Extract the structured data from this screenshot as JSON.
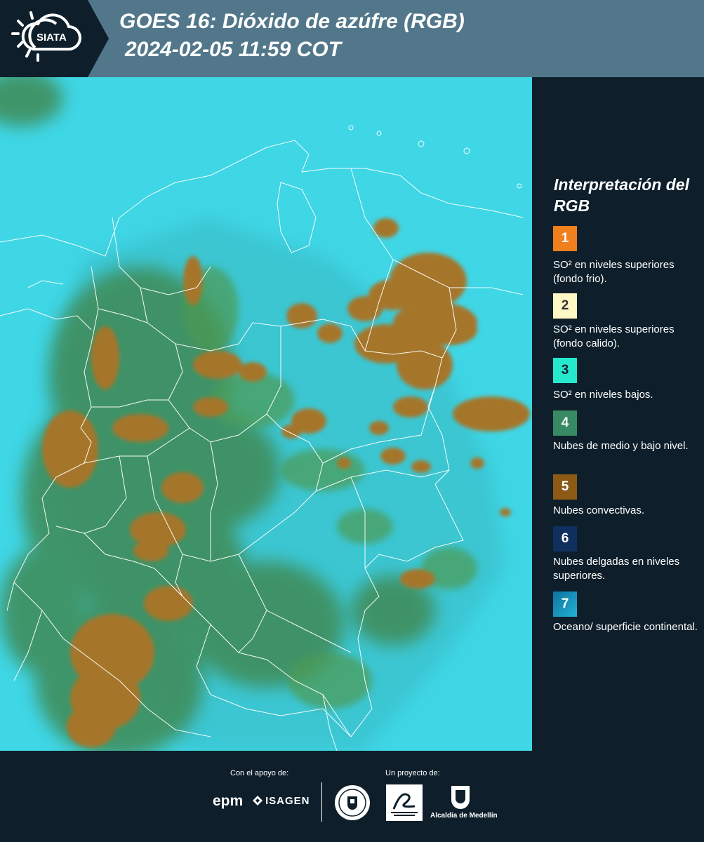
{
  "header": {
    "logo_text": "SIATA",
    "title_line1": "GOES 16: Dióxido de azúfre (RGB)",
    "title_line2": "2024-02-05 11:59 COT"
  },
  "legend": {
    "title": "Interpretación del RGB",
    "items": [
      {
        "number": "1",
        "label": "SO² en niveles superiores (fondo frio).",
        "color": "#f07f1d"
      },
      {
        "number": "2",
        "label": "SO² en niveles superiores (fondo calido).",
        "color": "#fdf8c4"
      },
      {
        "number": "3",
        "label": "SO² en niveles bajos.",
        "color": "#25e8cc"
      },
      {
        "number": "4",
        "label": "Nubes de medio y bajo nivel.",
        "color": "#378a63"
      },
      {
        "number": "5",
        "label": "Nubes convectivas.",
        "color": "#8c5a14"
      },
      {
        "number": "6",
        "label": "Nubes delgadas en niveles superiores.",
        "color": "#0f2f5e"
      },
      {
        "number": "7",
        "label": "Oceano/ superficie continental.",
        "color": "#1590b8"
      }
    ]
  },
  "footer": {
    "support_label": "Con el apoyo de:",
    "project_label": "Un proyecto de:",
    "sponsor1": "epm",
    "sponsor2": "ISAGEN",
    "partner_label": "Alcaldía de Medellín"
  },
  "colors": {
    "header_bg": "#52778a",
    "panel_bg": "#0e1f2b",
    "background_cyan": "#3fd6e6",
    "vegetation_green": "#3f8a55",
    "convective_brown": "#a5762a"
  }
}
